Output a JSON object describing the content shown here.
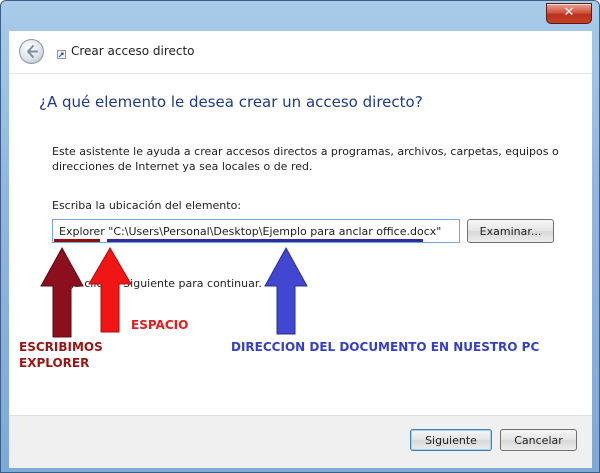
{
  "window": {
    "title": "Crear acceso directo",
    "close_label": "x"
  },
  "main": {
    "question": "¿A qué elemento le desea crear un acceso directo?",
    "description": "Este asistente le ayuda a crear accesos directos a programas, archivos, carpetas, equipos o direcciones de Internet ya sea locales o de red.",
    "location_label": "Escriba la ubicación del elemento:",
    "location_value": "Explorer \"C:\\Users\\Personal\\Desktop\\Ejemplo para anclar office.docx\"",
    "browse_label": "Examinar...",
    "continue_text": "Haga clic en Siguiente para continuar."
  },
  "annotations": {
    "escribimos": "ESCRIBIMOS\nEXPLORER",
    "espacio": "ESPACIO",
    "direccion": "DIRECCION DEL DOCUMENTO EN NUESTRO PC",
    "colors": {
      "escribimos": "#9a1616",
      "espacio": "#e01e1e",
      "direccion": "#3440c8"
    }
  },
  "footer": {
    "next_label": "Siguiente",
    "cancel_label": "Cancelar"
  },
  "icons": [
    "back-arrow-icon",
    "shortcut-icon",
    "close-icon"
  ]
}
